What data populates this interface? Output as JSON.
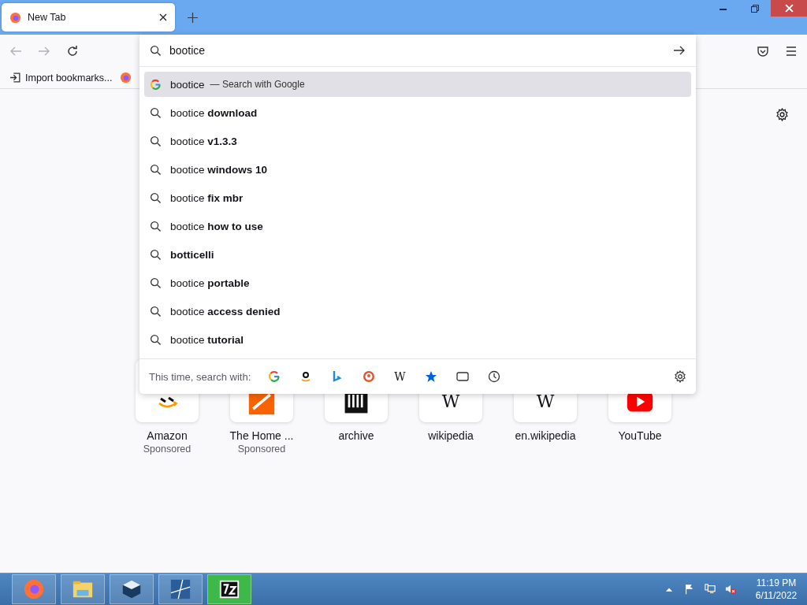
{
  "tabs": [
    {
      "label": "New Tab",
      "selected": true
    }
  ],
  "address_bar": {
    "value": "bootice"
  },
  "bookmarks": [
    {
      "label": "Import bookmarks...",
      "kind": "import"
    },
    {
      "kind": "firefox"
    }
  ],
  "suggestions": [
    {
      "text": "bootice",
      "hint": "— Search with Google",
      "kind": "engine",
      "selected": true
    },
    {
      "text": "bootice **download**",
      "kind": "search",
      "selected": false
    },
    {
      "text": "bootice **v1.3.3**",
      "kind": "search",
      "selected": false
    },
    {
      "text": "bootice **windows 10**",
      "kind": "search",
      "selected": false
    },
    {
      "text": "bootice **fix mbr**",
      "kind": "search",
      "selected": false
    },
    {
      "text": "bootice **how to use**",
      "kind": "search",
      "selected": false
    },
    {
      "text": "**botticelli**",
      "kind": "search",
      "selected": false
    },
    {
      "text": "bootice **portable**",
      "kind": "search",
      "selected": false
    },
    {
      "text": "bootice **access denied**",
      "kind": "search",
      "selected": false
    },
    {
      "text": "bootice **tutorial**",
      "kind": "search",
      "selected": false
    }
  ],
  "search_with": {
    "label": "This time, search with:",
    "engines": [
      {
        "kind": "google"
      },
      {
        "kind": "amazon"
      },
      {
        "kind": "bing"
      },
      {
        "kind": "duckduckgo"
      },
      {
        "kind": "wikipedia",
        "glyph": "W"
      },
      {
        "kind": "bookmarks"
      },
      {
        "kind": "tabs"
      },
      {
        "kind": "history"
      }
    ]
  },
  "top_sites": [
    {
      "title": "Amazon",
      "sponsored": "Sponsored",
      "kind": "amazon"
    },
    {
      "title": "The Home ...",
      "sponsored": "Sponsored",
      "kind": "homedepot"
    },
    {
      "title": "archive",
      "kind": "archive"
    },
    {
      "title": "wikipedia",
      "kind": "wiki",
      "glyph": "W"
    },
    {
      "title": "en.wikipedia",
      "kind": "wiki",
      "glyph": "W"
    },
    {
      "title": "YouTube",
      "kind": "youtube"
    }
  ],
  "taskbar": {
    "apps": [
      {
        "kind": "firefox",
        "selected": false
      },
      {
        "kind": "explorer",
        "selected": false
      },
      {
        "kind": "virtualbox",
        "selected": false
      },
      {
        "kind": "win10",
        "selected": false
      },
      {
        "kind": "archiver",
        "selected": true
      }
    ],
    "time": "11:19 PM",
    "date": "6/11/2022"
  }
}
